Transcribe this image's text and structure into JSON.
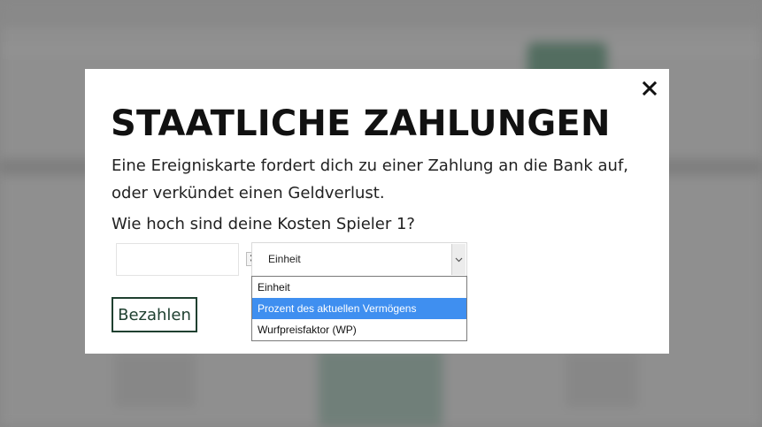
{
  "modal": {
    "title": "STAATLICHE ZAHLUNGEN",
    "description": "Eine Ereigniskarte fordert dich zu einer Zahlung an die Bank auf, oder verkündet einen Geldverlust.",
    "question": "Wie hoch sind deine Kosten Spieler 1?",
    "close_icon": "close-icon",
    "amount_input": {
      "value": "",
      "placeholder": ""
    },
    "unit_select": {
      "value": "Einheit",
      "options": [
        "Einheit",
        "Prozent des aktuellen Vermögens",
        "Wurfpreisfaktor (WP)"
      ],
      "highlighted_index": 1
    },
    "pay_label": "Bezahlen"
  },
  "colors": {
    "accent": "#1f4030",
    "highlight": "#3f8ff0",
    "backdrop": "#9a9a9a"
  }
}
